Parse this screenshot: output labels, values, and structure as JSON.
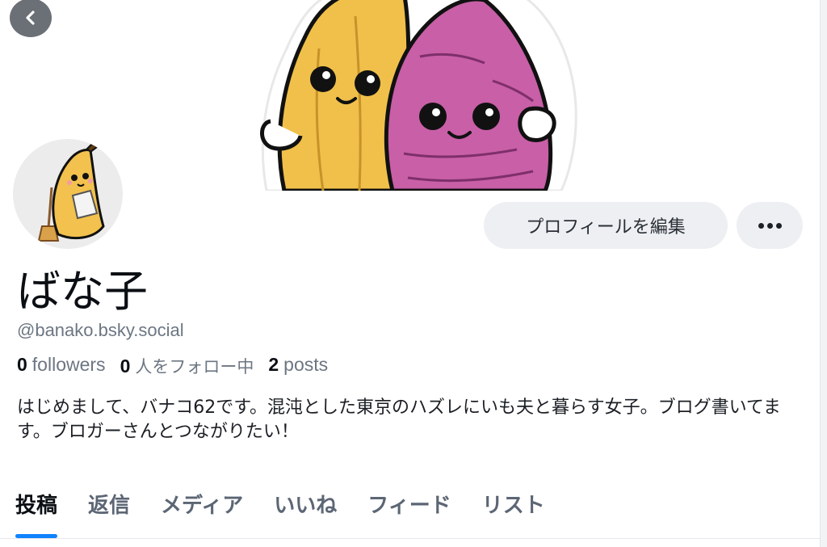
{
  "profile": {
    "display_name": "ばな子",
    "handle": "@banako.bsky.social",
    "stats": {
      "followers_count": "0",
      "followers_label": "followers",
      "following_count": "0",
      "following_label": "人をフォロー中",
      "posts_count": "2",
      "posts_label": "posts"
    },
    "bio": "はじめまして、バナコ62です。混沌とした東京のハズレにいも夫と暮らす女子。ブログ書いてます。ブロガーさんとつながりたい！"
  },
  "actions": {
    "edit_profile_label": "プロフィールを編集",
    "more_icon": "ellipsis-icon",
    "back_icon": "chevron-left-icon"
  },
  "tabs": [
    {
      "label": "投稿",
      "active": true
    },
    {
      "label": "返信",
      "active": false
    },
    {
      "label": "メディア",
      "active": false
    },
    {
      "label": "いいね",
      "active": false
    },
    {
      "label": "フィード",
      "active": false
    },
    {
      "label": "リスト",
      "active": false
    }
  ],
  "colors": {
    "accent": "#1083fe",
    "button_bg": "#edeff2",
    "muted_text": "#6c7682",
    "banana": "#f2c14e",
    "sweet_potato": "#c75fa8"
  }
}
